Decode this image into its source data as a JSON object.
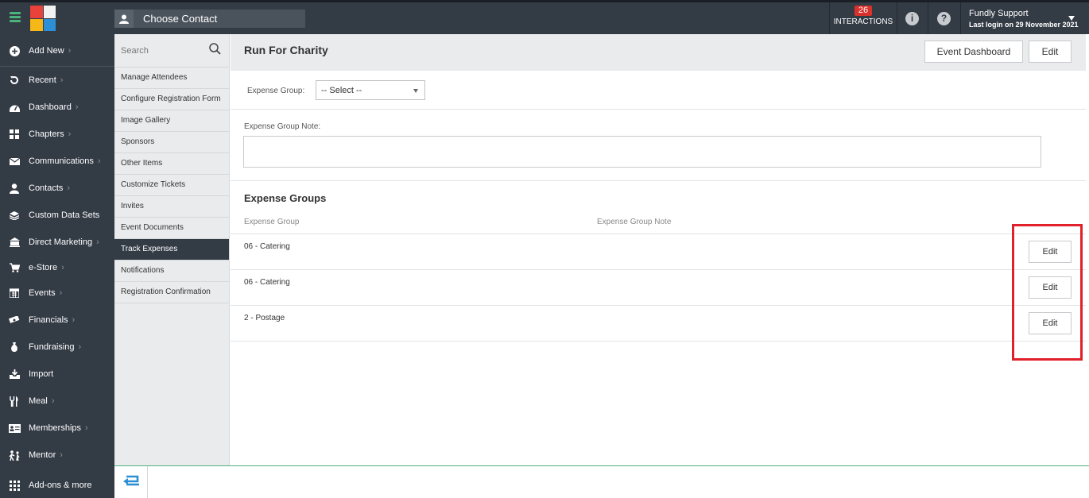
{
  "topbar": {
    "contact_placeholder": "Choose Contact",
    "interactions_count": "26",
    "interactions_label": "INTERACTIONS",
    "user_name": "Fundly Support",
    "last_login": "Last login on 29 November 2021"
  },
  "nav": {
    "items": [
      {
        "label": "Add New",
        "icon": "plus-circle-icon"
      },
      {
        "label": "Recent",
        "icon": "history-icon"
      },
      {
        "label": "Dashboard",
        "icon": "gauge-icon"
      },
      {
        "label": "Chapters",
        "icon": "grid-icon"
      },
      {
        "label": "Communications",
        "icon": "envelope-icon"
      },
      {
        "label": "Contacts",
        "icon": "person-icon"
      },
      {
        "label": "Custom Data Sets",
        "icon": "layers-icon"
      },
      {
        "label": "Direct Marketing",
        "icon": "bank-icon"
      },
      {
        "label": "e-Store",
        "icon": "cart-icon"
      },
      {
        "label": "Events",
        "icon": "calendar-icon"
      },
      {
        "label": "Financials",
        "icon": "money-icon"
      },
      {
        "label": "Fundraising",
        "icon": "money-bag-icon"
      },
      {
        "label": "Import",
        "icon": "import-icon"
      },
      {
        "label": "Meal",
        "icon": "cutlery-icon"
      },
      {
        "label": "Memberships",
        "icon": "id-card-icon"
      },
      {
        "label": "Mentor",
        "icon": "mentor-icon"
      },
      {
        "label": "Add-ons & more",
        "icon": "apps-icon"
      }
    ]
  },
  "subnav": {
    "search_placeholder": "Search",
    "items": [
      "Manage Attendees",
      "Configure Registration Form",
      "Image Gallery",
      "Sponsors",
      "Other Items",
      "Customize Tickets",
      "Invites",
      "Event Documents",
      "Track Expenses",
      "Notifications",
      "Registration Confirmation"
    ],
    "active_index": 8
  },
  "main": {
    "title": "Run For Charity",
    "event_dashboard_label": "Event Dashboard",
    "edit_label": "Edit",
    "expense_group_label": "Expense Group:",
    "expense_group_value": "-- Select --",
    "note_label": "Expense Group Note:",
    "section_title": "Expense Groups",
    "columns": [
      "Expense Group",
      "Expense Group Note"
    ],
    "rows": [
      {
        "group": "06 - Catering",
        "note": "",
        "action": "Edit"
      },
      {
        "group": "06 - Catering",
        "note": "",
        "action": "Edit"
      },
      {
        "group": "2 - Postage",
        "note": "",
        "action": "Edit"
      }
    ]
  },
  "colors": {
    "dark": "#333b45",
    "accent_green": "#4cb37c",
    "highlight_red": "#e0202a",
    "badge_red": "#d9312b"
  }
}
